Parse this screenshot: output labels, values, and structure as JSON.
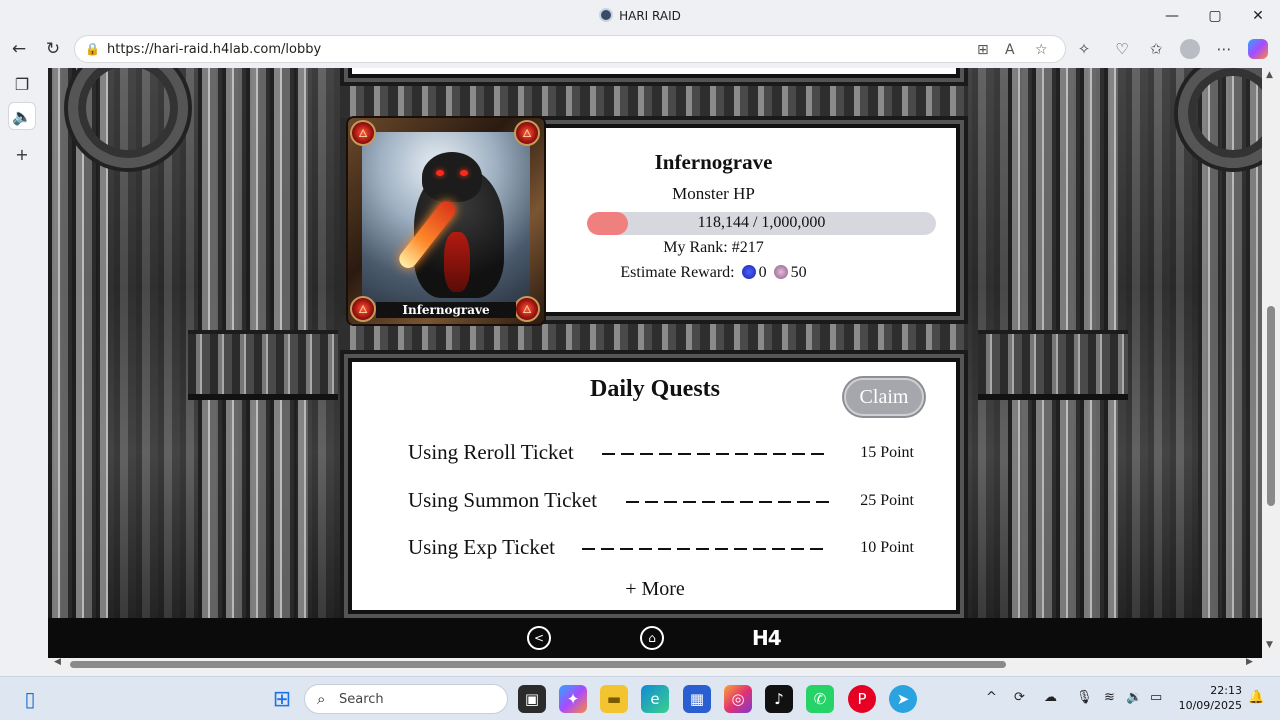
{
  "window": {
    "title": "HARI RAID",
    "controls": {
      "minimize": "—",
      "maximize": "▢",
      "close": "✕"
    }
  },
  "browser": {
    "url": "https://hari-raid.h4lab.com/lobby",
    "nav": {
      "back": "←",
      "refresh": "↻"
    }
  },
  "monster": {
    "name": "Infernograve",
    "card_name": "Infernograve",
    "hp_label": "Monster HP",
    "hp_text": "118,144 / 1,000,000",
    "hp_fraction": 0.118144,
    "rank": "My Rank: #217",
    "reward_label": "Estimate Reward:",
    "reward_blue_value": "0",
    "reward_pink_value": "50"
  },
  "quests": {
    "title": "Daily Quests",
    "claim_label": "Claim",
    "items": [
      {
        "label": "Using Reroll Ticket",
        "points": "15 Point"
      },
      {
        "label": "Using Summon Ticket",
        "points": "25 Point"
      },
      {
        "label": "Using Exp Ticket",
        "points": "10 Point"
      }
    ],
    "more_label": "+ More"
  },
  "game_nav": {
    "logo": "H4"
  },
  "taskbar": {
    "search_placeholder": "Search",
    "time": "22:13",
    "date": "10/09/2025"
  },
  "colors": {
    "hp_fill": "#f07f7f",
    "hp_track": "#d7d8de",
    "claim_disabled": "#a6a7ad",
    "game_nav_bg": "#0b0b0b"
  }
}
